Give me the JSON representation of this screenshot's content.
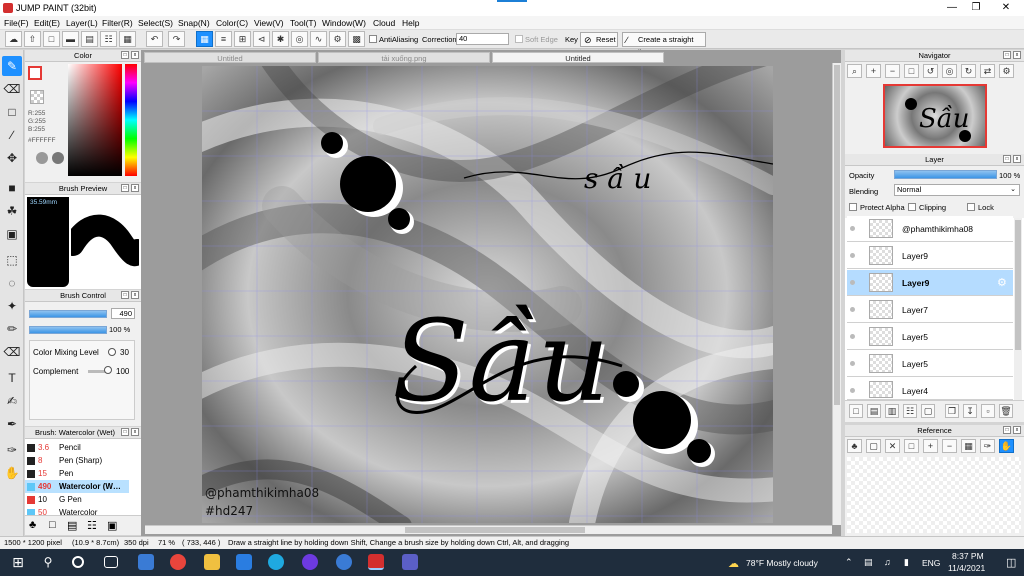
{
  "window": {
    "title": "JUMP PAINT (32bit)"
  },
  "menu": [
    "File(F)",
    "Edit(E)",
    "Layer(L)",
    "Filter(R)",
    "Select(S)",
    "Snap(N)",
    "Color(C)",
    "View(V)",
    "Tool(T)",
    "Window(W)",
    "Cloud",
    "Help"
  ],
  "toolbar": {
    "antialiasing_label": "AntiAliasing",
    "correction_label": "Correction",
    "correction_value": "40",
    "soft_edge_label": "Soft Edge",
    "key_label": "Key",
    "reset_label": "Reset",
    "straight_line_label": "Create a straight line"
  },
  "color_panel": {
    "title": "Color",
    "r": "R:255",
    "g": "G:255",
    "b": "B:255",
    "hex": "#FFFFFF",
    "fg_color": "#ffffff",
    "accent": "#ff0000"
  },
  "brush_preview": {
    "title": "Brush Preview",
    "size": "35.59mm"
  },
  "brush_control": {
    "title": "Brush Control",
    "size_value": "490",
    "opacity_value": "100 %",
    "color_mixing_label": "Color Mixing Level",
    "color_mixing_value": "30",
    "complement_label": "Complement",
    "complement_value": "100"
  },
  "brush_list": {
    "title": "Brush: Watercolor (Wet)",
    "items": [
      {
        "size": "3.6",
        "name": "Pencil",
        "color": "#222222"
      },
      {
        "size": "8",
        "name": "Pen (Sharp)",
        "color": "#222222"
      },
      {
        "size": "15",
        "name": "Pen",
        "color": "#222222"
      },
      {
        "size": "490",
        "name": "Watercolor (W…",
        "color": "#5ec7f7"
      },
      {
        "size": "10",
        "name": "G Pen",
        "color": "#e53935"
      },
      {
        "size": "50",
        "name": "Watercolor",
        "color": "#5ec7f7"
      }
    ]
  },
  "tabs": [
    "Untitled",
    "tải xuống.png",
    "Untitled"
  ],
  "artwork": {
    "main_word": "Sầu",
    "top_word": "s ầ u",
    "watermark_user": "@phamthikimha08",
    "watermark_tag": "#hd247"
  },
  "navigator": {
    "title": "Navigator"
  },
  "layer_panel": {
    "title": "Layer",
    "opacity_label": "Opacity",
    "opacity_value": "100 %",
    "opacity_level": 1.0,
    "blending_label": "Blending",
    "blending_value": "Normal",
    "protect_alpha_label": "Protect Alpha",
    "clipping_label": "Clipping",
    "lock_label": "Lock",
    "layers": [
      "@phamthikimha08",
      "Layer9",
      "Layer9",
      "Layer7",
      "Layer5",
      "Layer5",
      "Layer4"
    ]
  },
  "reference": {
    "title": "Reference"
  },
  "status": {
    "pixels": "1500 * 1200 pixel",
    "size": "(10.9 * 8.7cm)",
    "dpi": "350 dpi",
    "zoom": "71 %",
    "coords": "( 733, 446 )",
    "hint": "Draw a straight line by holding down Shift, Change a brush size by holding down Ctrl, Alt, and dragging"
  },
  "taskbar": {
    "weather": "78°F  Mostly cloudy",
    "lang": "ENG",
    "time": "8:37 PM",
    "date": "11/4/2021"
  }
}
